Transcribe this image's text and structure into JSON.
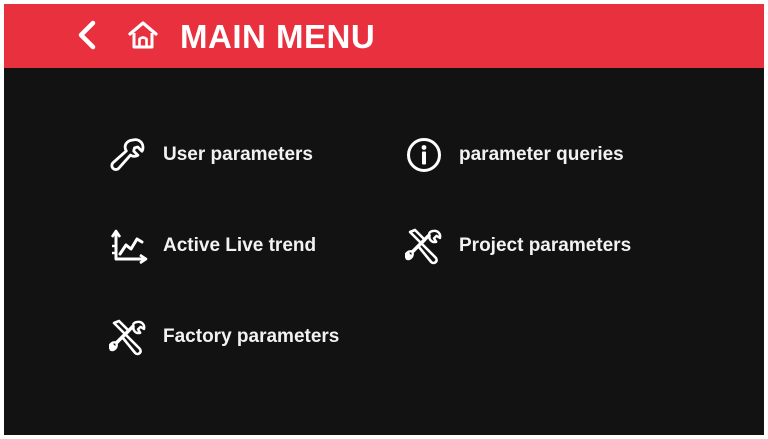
{
  "header": {
    "title": "MAIN MENU",
    "back_icon": "chevron-left-icon",
    "home_icon": "home-icon",
    "background_color": "#e8303f"
  },
  "screen": {
    "background_color": "#121212",
    "text_color": "#ffffff"
  },
  "menu": {
    "items": [
      {
        "label": "User parameters",
        "icon": "wrench-icon"
      },
      {
        "label": "parameter queries",
        "icon": "info-icon"
      },
      {
        "label": "Active Live trend",
        "icon": "trend-chart-icon"
      },
      {
        "label": "Project parameters",
        "icon": "tools-icon"
      },
      {
        "label": "Factory parameters",
        "icon": "tools-icon"
      }
    ]
  }
}
